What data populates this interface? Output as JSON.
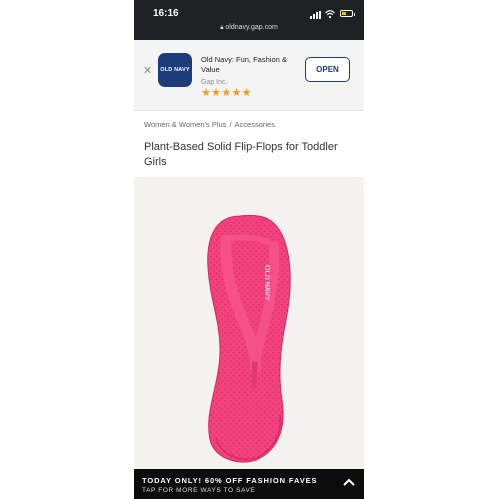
{
  "status_bar": {
    "time": "16:16",
    "url": "oldnavy.gap.com"
  },
  "app_banner": {
    "logo_text": "OLD NAVY",
    "title": "Old Navy: Fun, Fashion & Value",
    "publisher": "Gap Inc.",
    "stars": "★★★★★",
    "rating_stars": 5,
    "open_label": "OPEN",
    "brand_color": "#1c3d7a"
  },
  "breadcrumb": {
    "category": "Women & Women's Plus",
    "separator": "/",
    "subcategory": "Accessories"
  },
  "product": {
    "title": "Plant-Based Solid Flip-Flops for Toddler Girls",
    "image_icon": "pink-flip-flop",
    "image_color": "#f2457f"
  },
  "promo": {
    "title": "TODAY ONLY! 60% OFF FASHION FAVES",
    "subtitle": "TAP FOR MORE WAYS TO SAVE"
  }
}
